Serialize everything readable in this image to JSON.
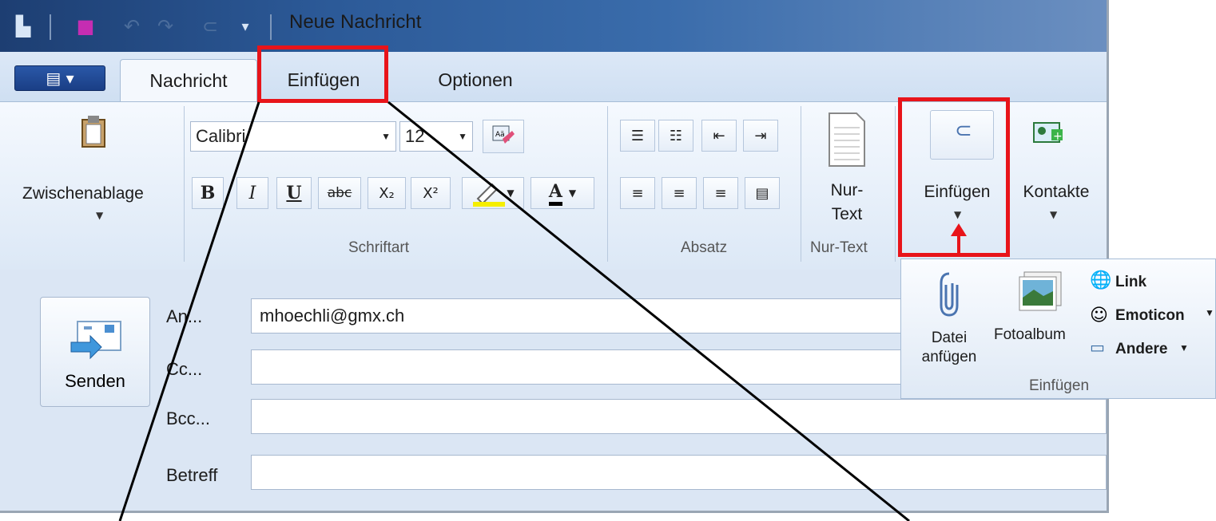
{
  "window": {
    "title": "Neue Nachricht"
  },
  "tabs": [
    {
      "label": "Nachricht"
    },
    {
      "label": "Einfügen"
    },
    {
      "label": "Optionen"
    }
  ],
  "ribbon": {
    "clipboard": {
      "label": "Zwischenablage"
    },
    "font": {
      "family": "Calibri",
      "size": "12",
      "group_label": "Schriftart",
      "bold": "B",
      "italic": "I",
      "underline": "U",
      "strike": "abc",
      "sub": "X₂",
      "sup": "X²",
      "fontcolor": "A"
    },
    "paragraph": {
      "group_label": "Absatz"
    },
    "plaintext": {
      "button_line1": "Nur-",
      "button_line2": "Text",
      "group_label": "Nur-Text"
    },
    "insert": {
      "label": "Einfügen"
    },
    "contacts": {
      "label": "Kontakte"
    }
  },
  "form": {
    "send_label": "Senden",
    "to_label": "An...",
    "to_value": "mhoechli@gmx.ch",
    "cc_label": "Cc...",
    "bcc_label": "Bcc...",
    "subject_label": "Betreff"
  },
  "popup": {
    "attach_line1": "Datei",
    "attach_line2": "anfügen",
    "album": "Fotoalbum",
    "link": "Link",
    "emoticon": "Emoticon",
    "other": "Andere",
    "group_label": "Einfügen"
  },
  "colors": {
    "highlight": "#e8141a",
    "accent": "#2a58a8"
  }
}
